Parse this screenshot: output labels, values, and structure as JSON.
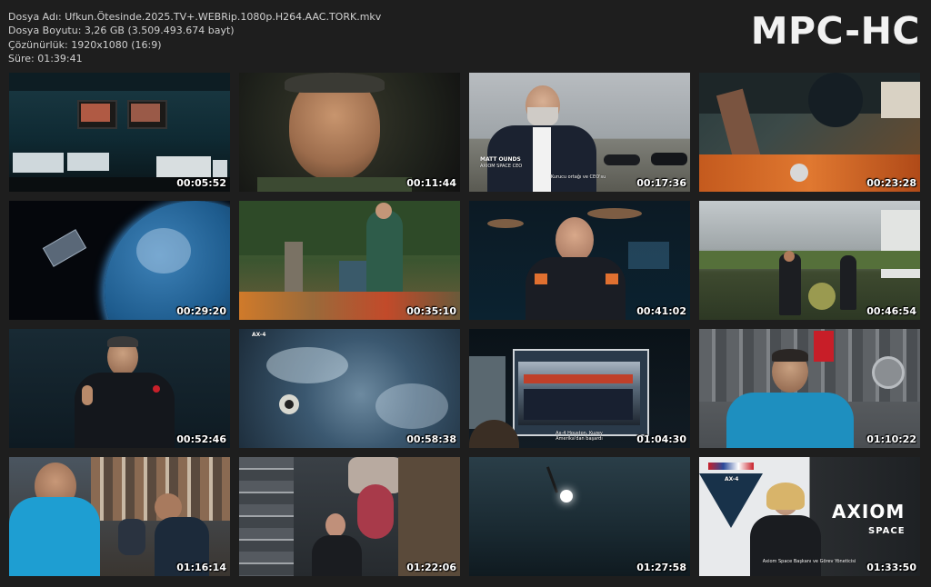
{
  "file_info": {
    "name": "Dosya Adı: Ufkun.Ötesinde.2025.TV+.WEBRip.1080p.H264.AAC.TORK.mkv",
    "size": "Dosya Boyutu: 3,26 GB (3.509.493.674 bayt)",
    "resolution": "Çözünürlük: 1920x1080 (16:9)",
    "duration": "Süre: 01:39:41"
  },
  "logo": "MPC-HC",
  "thumbnails": [
    {
      "timestamp": "00:05:52"
    },
    {
      "timestamp": "00:11:44"
    },
    {
      "timestamp": "00:17:36",
      "caption_name": "MATT OUNDS",
      "caption_role": "AXIOM SPACE CEO",
      "subtitle": "Kurucu ortağı ve CEO'su"
    },
    {
      "timestamp": "00:23:28"
    },
    {
      "timestamp": "00:29:20"
    },
    {
      "timestamp": "00:35:10"
    },
    {
      "timestamp": "00:41:02"
    },
    {
      "timestamp": "00:46:54"
    },
    {
      "timestamp": "00:52:46"
    },
    {
      "timestamp": "00:58:38",
      "badge": "AX-4"
    },
    {
      "timestamp": "01:04:30",
      "subtitle": "Ax-4 Houston, Kuzey Amerika'dan başardı"
    },
    {
      "timestamp": "01:10:22"
    },
    {
      "timestamp": "01:16:14"
    },
    {
      "timestamp": "01:22:06"
    },
    {
      "timestamp": "01:27:58"
    },
    {
      "timestamp": "01:33:50",
      "brand": "AXIOM",
      "brand_sub": "SPACE",
      "patch_label": "AX-4",
      "subtitle": "Axiom Space Başkanı ve Görev Yöneticisi"
    }
  ],
  "colors": {
    "background": "#1e1e1e",
    "text": "#d0d0d0",
    "logo": "#f2f2f2",
    "timestamp": "#ffffff"
  }
}
